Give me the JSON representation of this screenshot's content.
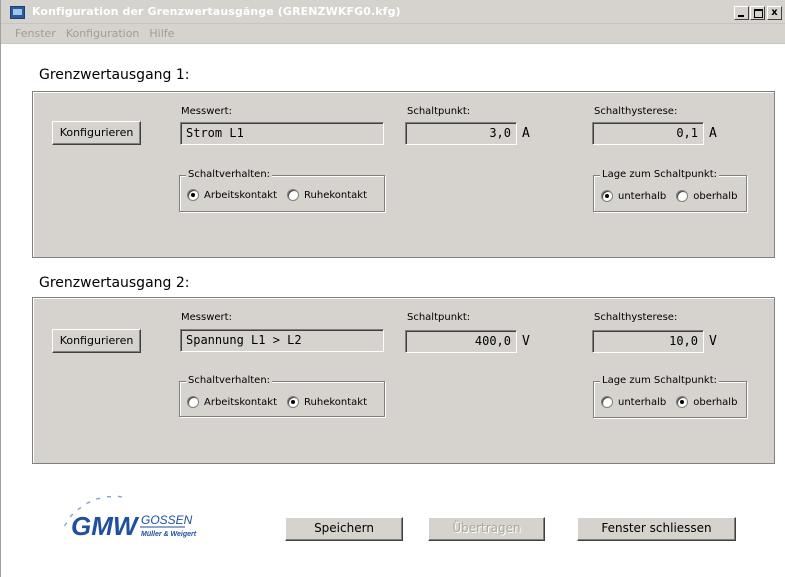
{
  "window": {
    "title": "Konfiguration der Grenzwertausgänge (GRENZWKFG0.kfg)",
    "controls": {
      "minimize": "_",
      "maximize": "□",
      "close": "x"
    }
  },
  "menu": [
    "Fenster",
    "Konfiguration",
    "Hilfe"
  ],
  "outputs": [
    {
      "title": "Grenzwertausgang 1:",
      "configure_label": "Konfigurieren",
      "messwert_label": "Messwert:",
      "messwert_value": "Strom L1",
      "schaltpunkt_label": "Schaltpunkt:",
      "schaltpunkt_value": "3,0",
      "schaltpunkt_unit": "A",
      "hysterese_label": "Schalthysterese:",
      "hysterese_value": "0,1",
      "hysterese_unit": "A",
      "schaltverhalten": {
        "legend": "Schaltverhalten:",
        "option1": "Arbeitskontakt",
        "option2": "Ruhekontakt",
        "selected": "Arbeitskontakt"
      },
      "lage": {
        "legend": "Lage zum Schaltpunkt:",
        "option1": "unterhalb",
        "option2": "oberhalb",
        "selected": "unterhalb"
      }
    },
    {
      "title": "Grenzwertausgang 2:",
      "configure_label": "Konfigurieren",
      "messwert_label": "Messwert:",
      "messwert_value": "Spannung L1 > L2",
      "schaltpunkt_label": "Schaltpunkt:",
      "schaltpunkt_value": "400,0",
      "schaltpunkt_unit": "V",
      "hysterese_label": "Schalthysterese:",
      "hysterese_value": "10,0",
      "hysterese_unit": "V",
      "schaltverhalten": {
        "legend": "Schaltverhalten:",
        "option1": "Arbeitskontakt",
        "option2": "Ruhekontakt",
        "selected": "Ruhekontakt"
      },
      "lage": {
        "legend": "Lage zum Schaltpunkt:",
        "option1": "unterhalb",
        "option2": "oberhalb",
        "selected": "oberhalb"
      }
    }
  ],
  "footer": {
    "logo": {
      "brand": "GMW",
      "name": "GOSSEN",
      "subtitle": "Müller & Weigert",
      "color": "#1f4fa0"
    },
    "save_label": "Speichern",
    "transfer_label": "Übertragen",
    "transfer_enabled": false,
    "close_label": "Fenster schliessen"
  }
}
